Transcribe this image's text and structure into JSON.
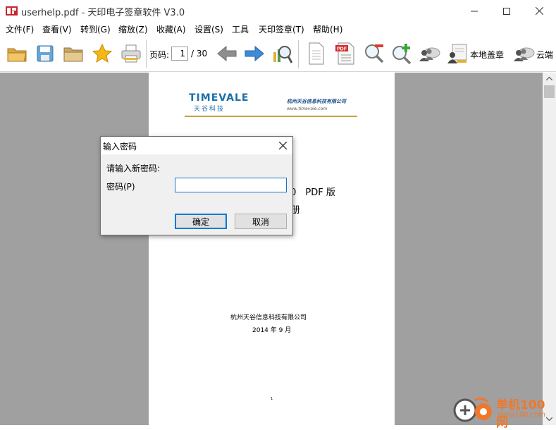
{
  "window": {
    "title": "userhelp.pdf - 天印电子签章软件 V3.0"
  },
  "menu": [
    "文件(F)",
    "查看(V)",
    "转到(G)",
    "缩放(Z)",
    "收藏(A)",
    "设置(S)",
    "工具",
    "天印签章(T)",
    "帮助(H)"
  ],
  "toolbar": {
    "page_label": "页码:",
    "page_current": "1",
    "page_total": "/ 30",
    "local_stamp_label": "本地盖章",
    "cloud_stamp_label": "云端",
    "pdf_badge": "PDF"
  },
  "document": {
    "logo_text": "TIMEVALE",
    "logo_sub": "天谷科技",
    "header_company": "杭州天谷信息科技有限公司",
    "header_url": "www.timevale.com",
    "title_line1": ".0　PDF 版",
    "title_line2": "册",
    "footer_company": "杭州天谷信息科技有限公司",
    "footer_date": "2014 年 9 月",
    "page_number": "1"
  },
  "dialog": {
    "title": "输入密码",
    "prompt": "请输入新密码:",
    "password_label": "密码(P)",
    "password_value": "",
    "ok_label": "确定",
    "cancel_label": "取消"
  },
  "watermark": {
    "text_main": "单机100网",
    "text_url": "danji100.com"
  },
  "colors": {
    "canvas_bg": "#a0a0a0",
    "logo_blue": "#1b6ea9",
    "accent_gold": "#c8a23c",
    "dialog_focus": "#0078d7",
    "watermark_orange": "#f0782c"
  }
}
